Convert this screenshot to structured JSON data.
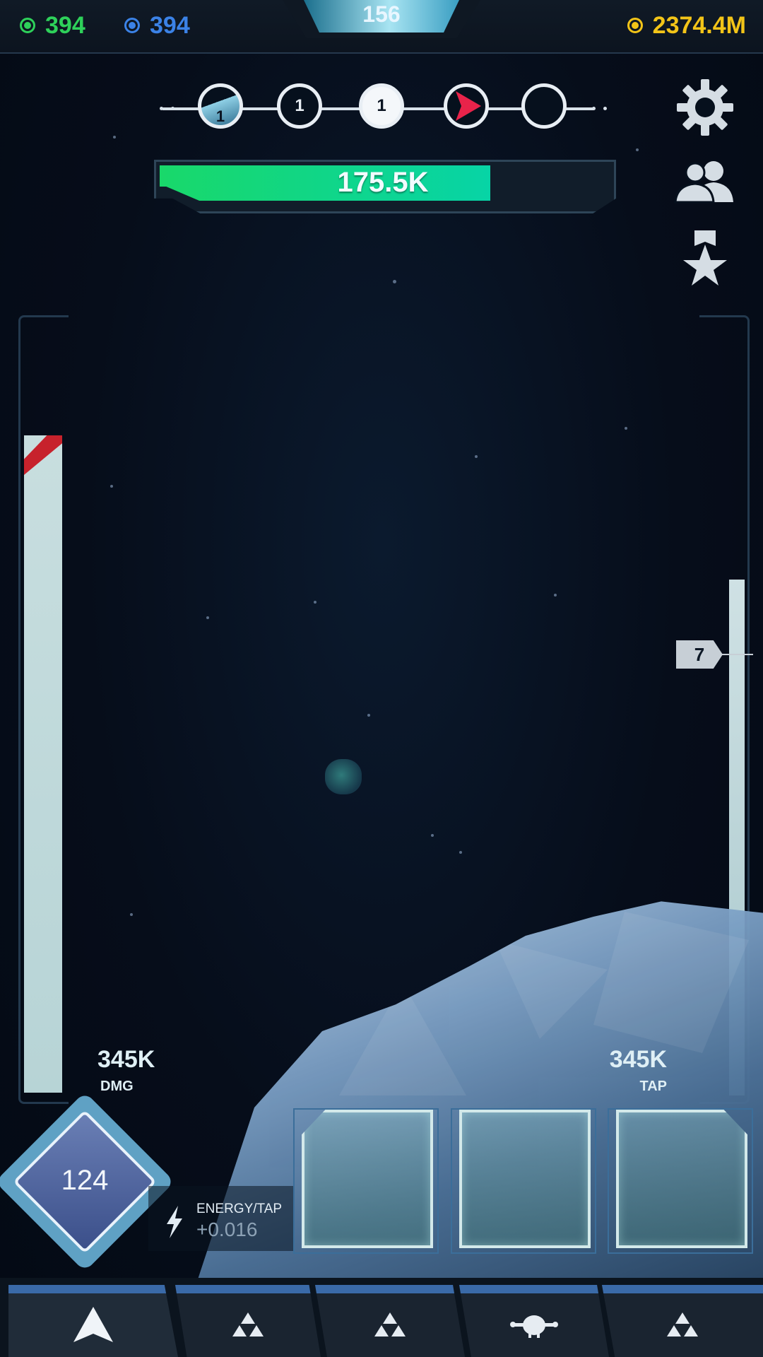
{
  "currencies": {
    "green_value": "394",
    "blue_value": "394",
    "gold_value": "2374.4M",
    "green_color": "#2ed15a",
    "blue_color": "#3b82e6",
    "gold_color": "#f2c418"
  },
  "level": {
    "number": "156"
  },
  "stages": [
    {
      "label": "1",
      "kind": "boss"
    },
    {
      "label": "1",
      "kind": "outlined"
    },
    {
      "label": "1",
      "kind": "active"
    },
    {
      "label": "",
      "kind": "flag",
      "color": "#e8234a"
    },
    {
      "label": "",
      "kind": "empty"
    }
  ],
  "enemy": {
    "hp_text": "175.5K",
    "hp_fraction": 0.74
  },
  "side_icons": [
    "gear-icon",
    "team-icon",
    "achievement-icon"
  ],
  "right_marker": {
    "label": "7"
  },
  "stats": {
    "dmg_value": "345K",
    "dmg_label": "DMG",
    "tap_value": "345K",
    "tap_label": "TAP"
  },
  "player": {
    "level": "124",
    "energy_label": "ENERGY/TAP",
    "energy_value": "+0.016"
  },
  "nav": [
    "ship-icon",
    "upgrade-icon",
    "upgrade-icon",
    "planet-icon",
    "upgrade-icon"
  ]
}
